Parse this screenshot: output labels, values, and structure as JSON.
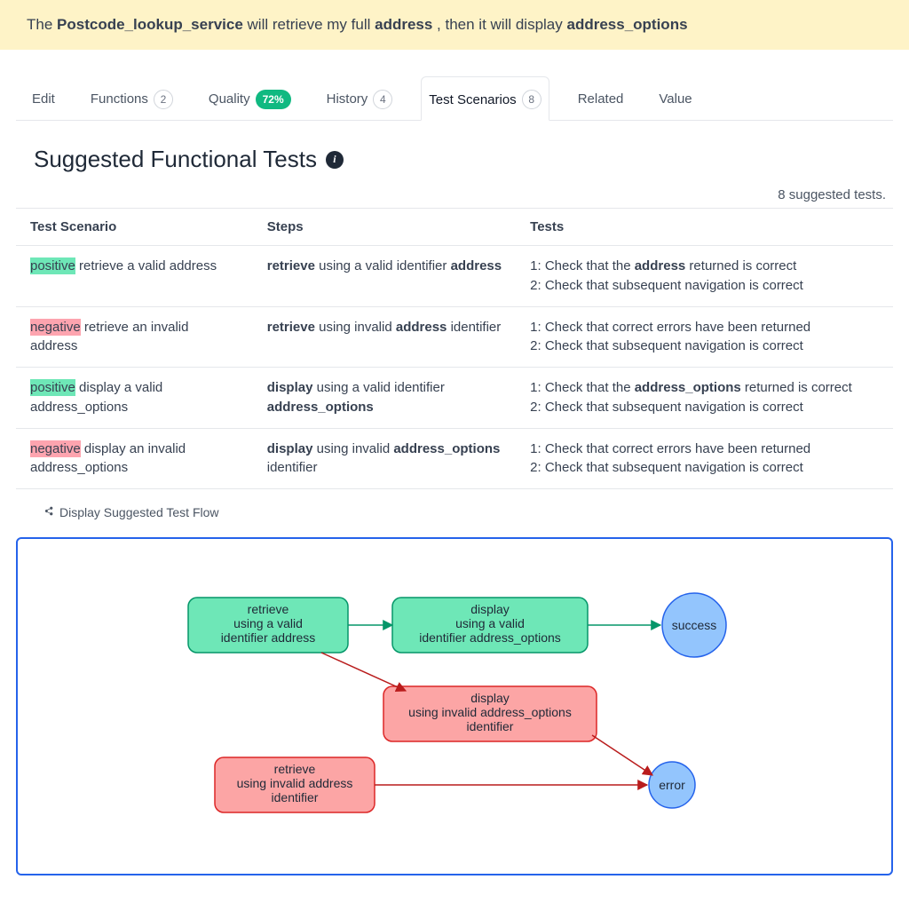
{
  "banner": {
    "prefix": "The ",
    "subject": "Postcode_lookup_service",
    "mid1": " will retrieve my full ",
    "obj1": "address",
    "mid2": " , then it will display ",
    "obj2": "address_options"
  },
  "tabs": {
    "edit": "Edit",
    "functions": "Functions",
    "functions_count": "2",
    "quality": "Quality",
    "quality_pct": "72%",
    "history": "History",
    "history_count": "4",
    "scenarios": "Test Scenarios",
    "scenarios_count": "8",
    "related": "Related",
    "value": "Value"
  },
  "section_title": "Suggested Functional Tests",
  "count_line": "8 suggested tests.",
  "columns": {
    "scenario": "Test Scenario",
    "steps": "Steps",
    "tests": "Tests"
  },
  "rows": [
    {
      "tag": "positive",
      "tag_class": "positive",
      "scenario_rest": " retrieve a valid address",
      "steps_prefix": "retrieve",
      "steps_mid": " using a valid identifier ",
      "steps_bold2": "address",
      "steps_suffix": "",
      "t1": "1: Check that the ",
      "t1b": "address",
      "t1s": " returned is correct",
      "t2": "2: Check that subsequent navigation is correct"
    },
    {
      "tag": "negative",
      "tag_class": "negative",
      "scenario_rest": " retrieve an invalid address",
      "steps_prefix": "retrieve",
      "steps_mid": " using invalid ",
      "steps_bold2": "address",
      "steps_suffix": " identifier",
      "t1": "1: Check that correct errors have been returned",
      "t1b": "",
      "t1s": "",
      "t2": "2: Check that subsequent navigation is correct"
    },
    {
      "tag": "positive",
      "tag_class": "positive",
      "scenario_rest": " display a valid address_options",
      "steps_prefix": "display",
      "steps_mid": " using a valid identifier ",
      "steps_bold2": "address_options",
      "steps_suffix": "",
      "t1": "1: Check that the ",
      "t1b": "address_options",
      "t1s": " returned is correct",
      "t2": "2: Check that subsequent navigation is correct"
    },
    {
      "tag": "negative",
      "tag_class": "negative",
      "scenario_rest": " display an invalid address_options",
      "steps_prefix": "display",
      "steps_mid": " using invalid ",
      "steps_bold2": "address_options",
      "steps_suffix": " identifier",
      "t1": "1: Check that correct errors have been returned",
      "t1b": "",
      "t1s": "",
      "t2": "2: Check that subsequent navigation is correct"
    }
  ],
  "flow_toggle": "Display Suggested Test Flow",
  "diagram": {
    "n1_l1": "retrieve",
    "n1_l2": "using a valid",
    "n1_l3a": "identifier ",
    "n1_l3b": "address",
    "n2_l1": "display",
    "n2_l2": "using a valid",
    "n2_l3a": "identifier ",
    "n2_l3b": "address_options",
    "n3_l1": "display",
    "n3_l2a": "using invalid ",
    "n3_l2b": "address_options",
    "n3_l3": "identifier",
    "n4_l1": "retrieve",
    "n4_l2a": "using invalid ",
    "n4_l2b": "address",
    "n4_l3": "identifier",
    "success": "success",
    "error": "error"
  }
}
